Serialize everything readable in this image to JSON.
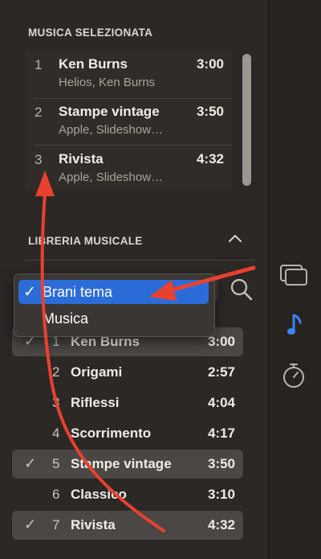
{
  "selected_music": {
    "title": "MUSICA SELEZIONATA",
    "tracks": [
      {
        "num": "1",
        "title": "Ken Burns",
        "artist": "Helios, Ken Burns",
        "duration": "3:00"
      },
      {
        "num": "2",
        "title": "Stampe vintage",
        "artist": "Apple, Slideshow…",
        "duration": "3:50"
      },
      {
        "num": "3",
        "title": "Rivista",
        "artist": "Apple, Slideshow…",
        "duration": "4:32"
      }
    ]
  },
  "library": {
    "title": "LIBRERIA MUSICALE",
    "filter_menu": {
      "items": [
        {
          "label": "Brani tema",
          "checked": "✓"
        },
        {
          "label": "Musica"
        }
      ]
    },
    "tracks": [
      {
        "num": "1",
        "title": "Ken Burns",
        "duration": "3:00",
        "check": "✓"
      },
      {
        "num": "2",
        "title": "Origami",
        "duration": "2:57",
        "check": ""
      },
      {
        "num": "3",
        "title": "Riflessi",
        "duration": "4:04",
        "check": ""
      },
      {
        "num": "4",
        "title": "Scorrimento",
        "duration": "4:17",
        "check": ""
      },
      {
        "num": "5",
        "title": "Stampe vintage",
        "duration": "3:50",
        "check": "✓"
      },
      {
        "num": "6",
        "title": "Classico",
        "duration": "3:10",
        "check": ""
      },
      {
        "num": "7",
        "title": "Rivista",
        "duration": "4:32",
        "check": "✓"
      }
    ]
  },
  "side_toolbar": {
    "icons": [
      "slideshow-themes-icon",
      "music-note-icon",
      "timer-icon"
    ],
    "active": "music-note-icon"
  },
  "annotations": {
    "arrow_color": "#e8412f"
  },
  "colors": {
    "accent": "#2c6cd9",
    "background": "#2b2826",
    "music_icon": "#3b82f6"
  }
}
